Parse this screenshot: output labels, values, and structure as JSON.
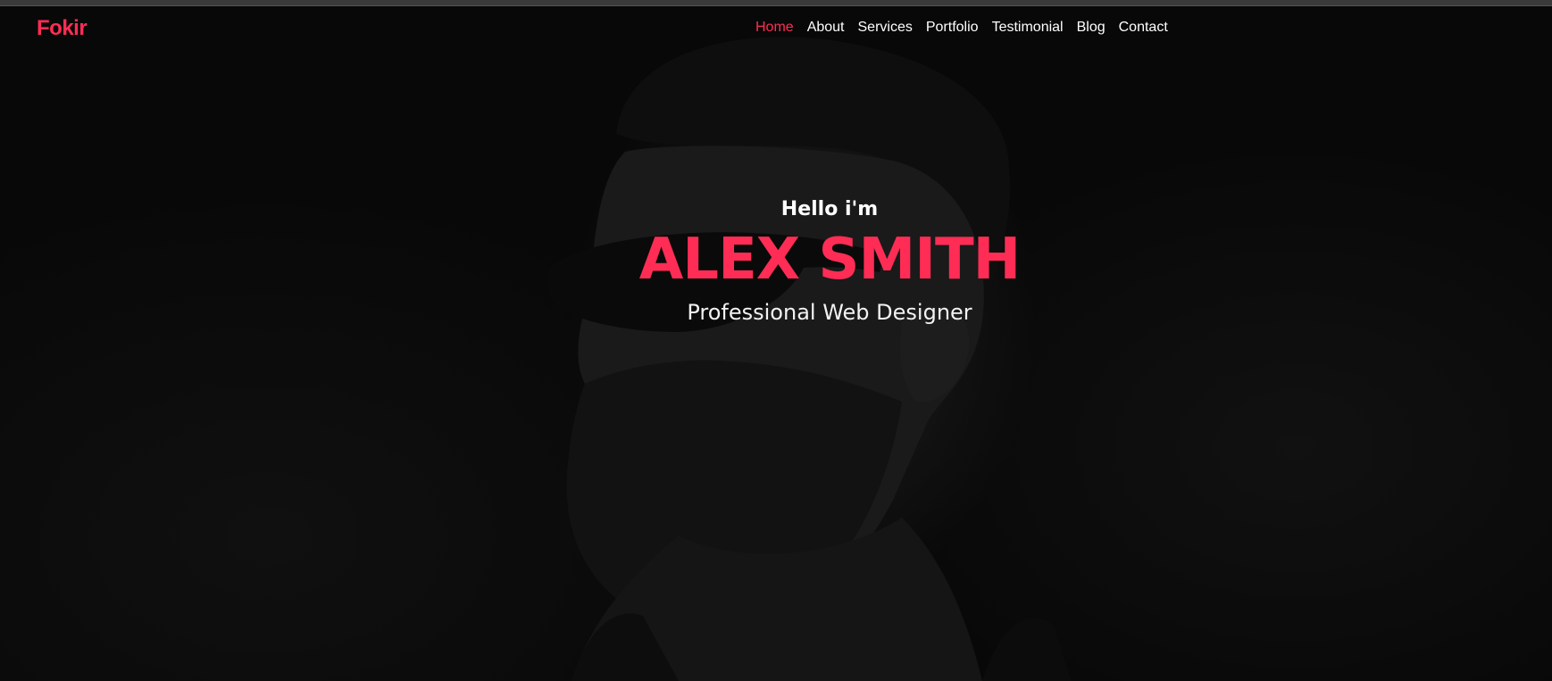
{
  "brand": {
    "logo_text": "Fokir",
    "accent_color": "#ff2d55"
  },
  "nav": {
    "items": [
      {
        "label": "Home",
        "active": true
      },
      {
        "label": "About",
        "active": false
      },
      {
        "label": "Services",
        "active": false
      },
      {
        "label": "Portfolio",
        "active": false
      },
      {
        "label": "Testimonial",
        "active": false
      },
      {
        "label": "Blog",
        "active": false
      },
      {
        "label": "Contact",
        "active": false
      }
    ]
  },
  "hero": {
    "greeting": "Hello i'm",
    "name": "ALEX SMITH",
    "role": "Professional Web Designer",
    "background": "portrait-photo"
  }
}
